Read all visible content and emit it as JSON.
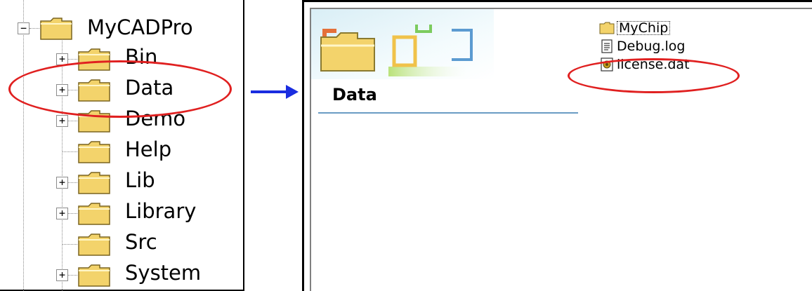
{
  "tree": {
    "items": [
      {
        "label": "MyCADPro",
        "expander": "−",
        "level": 0
      },
      {
        "label": "Bin",
        "expander": "+",
        "level": 1
      },
      {
        "label": "Data",
        "expander": "+",
        "level": 1
      },
      {
        "label": "Demo",
        "expander": "+",
        "level": 1
      },
      {
        "label": "Help",
        "expander": "",
        "level": 1
      },
      {
        "label": "Lib",
        "expander": "+",
        "level": 1
      },
      {
        "label": "Library",
        "expander": "+",
        "level": 1
      },
      {
        "label": "Src",
        "expander": "",
        "level": 1
      },
      {
        "label": "System",
        "expander": "+",
        "level": 1
      }
    ]
  },
  "explorer": {
    "folder_title": "Data",
    "files": [
      {
        "name": "MyChip",
        "icon": "folder-icon"
      },
      {
        "name": "Debug.log",
        "icon": "text-file-icon"
      },
      {
        "name": "license.dat",
        "icon": "dat-file-icon"
      }
    ]
  },
  "colors": {
    "highlight": "#e02020",
    "arrow": "#1a2de0",
    "folder": "#f3d36b",
    "rule": "#6a9cc4"
  }
}
